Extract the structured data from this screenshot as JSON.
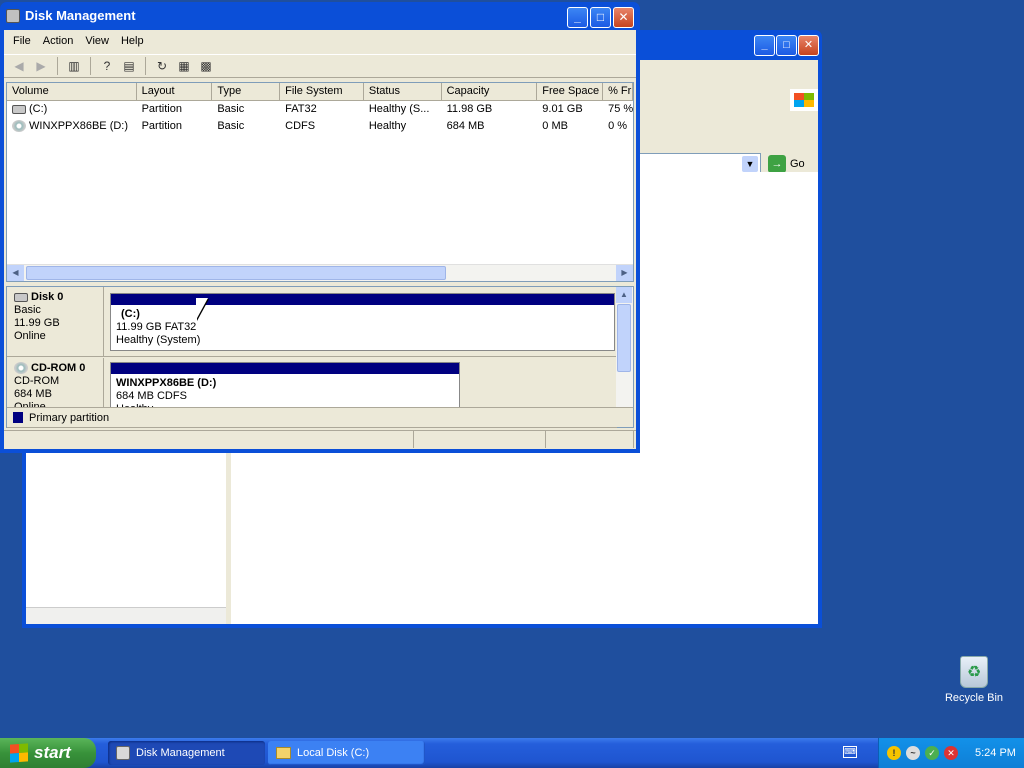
{
  "background_window": {
    "address_go": "Go"
  },
  "disk_mgmt": {
    "title": "Disk Management",
    "menu": [
      "File",
      "Action",
      "View",
      "Help"
    ],
    "columns": [
      "Volume",
      "Layout",
      "Type",
      "File System",
      "Status",
      "Capacity",
      "Free Space",
      "% Fr"
    ],
    "rows": [
      {
        "volume": "(C:)",
        "layout": "Partition",
        "type": "Basic",
        "fs": "FAT32",
        "status": "Healthy (S...",
        "capacity": "11.98 GB",
        "free": "9.01 GB",
        "pct": "75 %"
      },
      {
        "volume": "WINXPPX86BE (D:)",
        "layout": "Partition",
        "type": "Basic",
        "fs": "CDFS",
        "status": "Healthy",
        "capacity": "684 MB",
        "free": "0 MB",
        "pct": "0 %"
      }
    ],
    "disks": [
      {
        "name": "Disk 0",
        "kind": "Basic",
        "size": "11.99 GB",
        "state": "Online",
        "partition": {
          "label": "(C:)",
          "detail": "11.99 GB FAT32",
          "status": "Healthy (System)"
        }
      },
      {
        "name": "CD-ROM 0",
        "kind": "CD-ROM",
        "size": "684 MB",
        "state": "Online",
        "partition": {
          "label": "WINXPPX86BE  (D:)",
          "detail": "684 MB CDFS",
          "status": "Healthy"
        }
      }
    ],
    "legend": "Primary partition"
  },
  "desktop": {
    "recycle_bin": "Recycle Bin"
  },
  "taskbar": {
    "start": "start",
    "tasks": [
      "Disk Management",
      "Local Disk (C:)"
    ],
    "clock": "5:24 PM"
  }
}
